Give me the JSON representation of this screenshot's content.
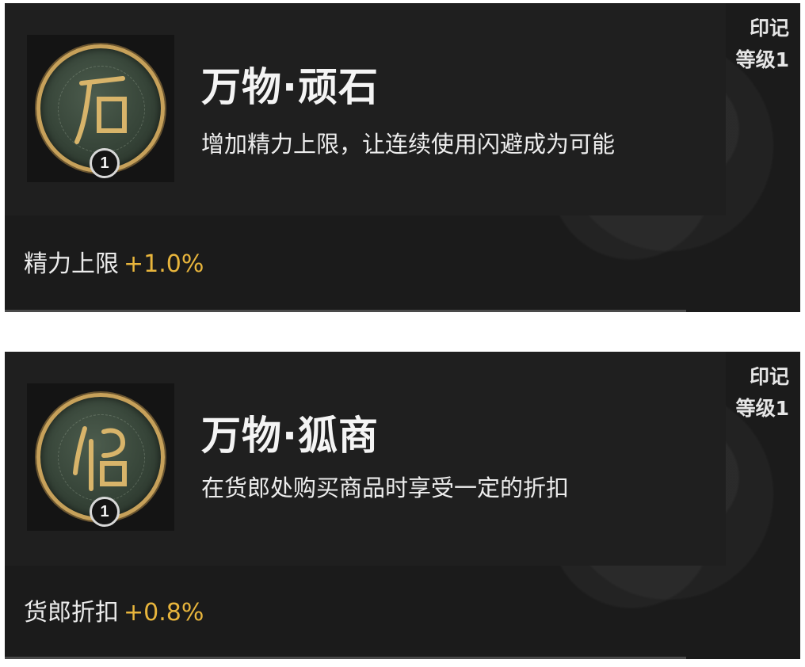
{
  "cards": [
    {
      "title": "万物·顽石",
      "description": "增加精力上限，让连续使用闪避成为可能",
      "tag": "印记",
      "level": "等级1",
      "badge": "1",
      "stat_label": "精力上限",
      "stat_value": "+1.0%",
      "icon": "stone-rune-coin-icon"
    },
    {
      "title": "万物·狐商",
      "description": "在货郎处购买商品时享受一定的折扣",
      "tag": "印记",
      "level": "等级1",
      "badge": "1",
      "stat_label": "货郎折扣",
      "stat_value": "+0.8%",
      "icon": "fox-merchant-rune-coin-icon"
    }
  ],
  "colors": {
    "card_bg": "#1b1b1b",
    "accent_gold": "#e8b53c",
    "coin_rim": "#c7a15a",
    "coin_face": "#3e4c40"
  }
}
